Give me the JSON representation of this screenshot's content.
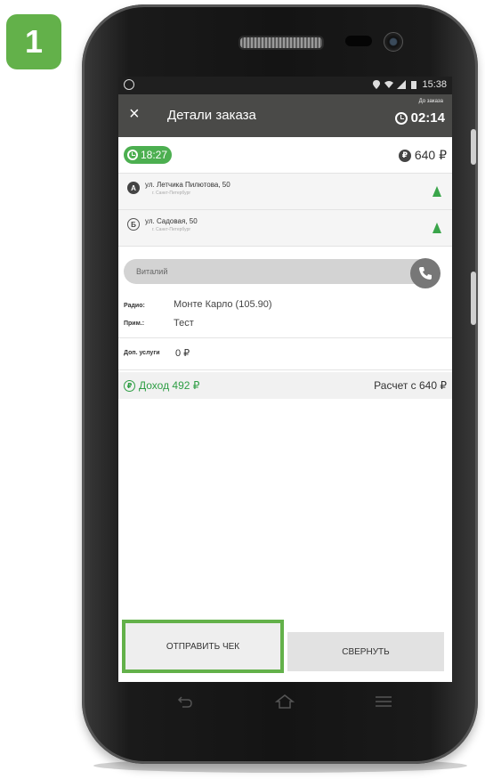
{
  "step_number": "1",
  "status_bar": {
    "time": "15:38"
  },
  "header": {
    "close": "×",
    "title": "Детали заказа",
    "timer_label": "До заказа",
    "timer_value": "02:14"
  },
  "order": {
    "time": "18:27",
    "price": "640 ₽",
    "addresses": [
      {
        "badge": "А",
        "street": "ул. Летчика Пилютова, 50",
        "city": "г. Санкт-Петербург"
      },
      {
        "badge": "Б",
        "street": "ул. Садовая, 50",
        "city": "г. Санкт-Петербург"
      }
    ],
    "client_name": "Виталий",
    "radio_label": "Радио:",
    "radio_value": "Монте Карло (105.90)",
    "note_label": "Прим.:",
    "note_value": "Тест",
    "extra_label": "Доп. услуги",
    "extra_value": "0 ₽",
    "income": "Доход 492 ₽",
    "calc": "Расчет с 640 ₽"
  },
  "buttons": {
    "send_receipt": "ОТПРАВИТЬ ЧЕК",
    "collapse": "СВЕРНУТЬ"
  },
  "colors": {
    "accent_green": "#4caf50",
    "highlight_green": "#63b14a",
    "appbar": "#4a4a48"
  }
}
